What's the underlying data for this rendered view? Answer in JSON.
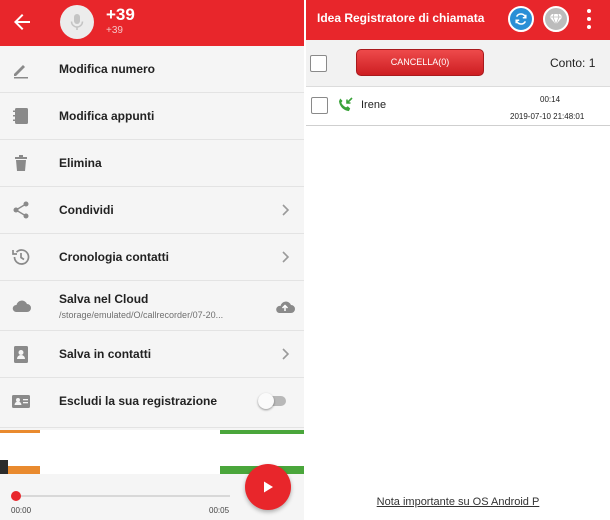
{
  "left": {
    "header": {
      "title": "+39",
      "subtitle": "+39"
    },
    "menu": [
      {
        "label": "Modifica numero"
      },
      {
        "label": "Modifica appunti"
      },
      {
        "label": "Elimina"
      },
      {
        "label": "Condividi"
      },
      {
        "label": "Cronologia contatti"
      },
      {
        "label": "Salva nel Cloud",
        "sub": "/storage/emulated/O/callrecorder/07-20..."
      },
      {
        "label": "Salva in contatti"
      },
      {
        "label": "Escludi la sua registrazione",
        "toggle_on": false
      }
    ],
    "player": {
      "time_start": "00:00",
      "time_end": "00:05",
      "progress": 0
    }
  },
  "right": {
    "header": {
      "title": "Idea Registratore di chiamata"
    },
    "toolbar": {
      "delete_label": "CANCELLA(0)",
      "count_label": "Conto: 1"
    },
    "calls": [
      {
        "name": "Irene",
        "duration": "00:14",
        "datetime": "2019-07-10 21:48:01"
      }
    ],
    "note_link": "Nota importante su OS Android P"
  },
  "colors": {
    "accent": "#e8262b",
    "call_icon": "#3aa33a",
    "sync": "#2a8fd6"
  }
}
